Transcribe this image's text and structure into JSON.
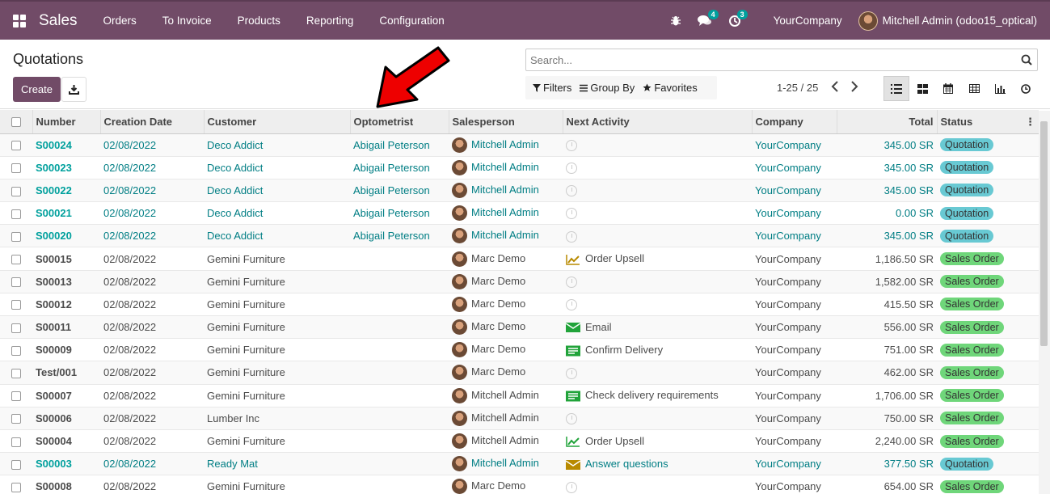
{
  "nav": {
    "brand": "Sales",
    "menu": [
      "Orders",
      "To Invoice",
      "Products",
      "Reporting",
      "Configuration"
    ],
    "messages_badge": "4",
    "activities_badge": "3",
    "company": "YourCompany",
    "user": "Mitchell Admin (odoo15_optical)"
  },
  "control_panel": {
    "title": "Quotations",
    "create_label": "Create",
    "search_placeholder": "Search...",
    "filters_label": "Filters",
    "group_by_label": "Group By",
    "favorites_label": "Favorites",
    "pager": "1-25 / 25"
  },
  "table": {
    "headers": [
      "Number",
      "Creation Date",
      "Customer",
      "Optometrist",
      "Salesperson",
      "Next Activity",
      "Company",
      "Total",
      "Status"
    ],
    "rows": [
      {
        "number": "S00024",
        "date": "02/08/2022",
        "customer": "Deco Addict",
        "optometrist": "Abigail Peterson",
        "salesperson": "Mitchell Admin",
        "activity": "",
        "activity_icon": "clock-icon",
        "company": "YourCompany",
        "total": "345.00 SR",
        "status": "Quotation",
        "type": "quote"
      },
      {
        "number": "S00023",
        "date": "02/08/2022",
        "customer": "Deco Addict",
        "optometrist": "Abigail Peterson",
        "salesperson": "Mitchell Admin",
        "activity": "",
        "activity_icon": "clock-icon",
        "company": "YourCompany",
        "total": "345.00 SR",
        "status": "Quotation",
        "type": "quote"
      },
      {
        "number": "S00022",
        "date": "02/08/2022",
        "customer": "Deco Addict",
        "optometrist": "Abigail Peterson",
        "salesperson": "Mitchell Admin",
        "activity": "",
        "activity_icon": "clock-icon",
        "company": "YourCompany",
        "total": "345.00 SR",
        "status": "Quotation",
        "type": "quote"
      },
      {
        "number": "S00021",
        "date": "02/08/2022",
        "customer": "Deco Addict",
        "optometrist": "Abigail Peterson",
        "salesperson": "Mitchell Admin",
        "activity": "",
        "activity_icon": "clock-icon",
        "company": "YourCompany",
        "total": "0.00 SR",
        "status": "Quotation",
        "type": "quote"
      },
      {
        "number": "S00020",
        "date": "02/08/2022",
        "customer": "Deco Addict",
        "optometrist": "Abigail Peterson",
        "salesperson": "Mitchell Admin",
        "activity": "",
        "activity_icon": "clock-icon",
        "company": "YourCompany",
        "total": "345.00 SR",
        "status": "Quotation",
        "type": "quote"
      },
      {
        "number": "S00015",
        "date": "02/08/2022",
        "customer": "Gemini Furniture",
        "optometrist": "",
        "salesperson": "Marc Demo",
        "activity": "Order Upsell",
        "activity_icon": "upsell-icon",
        "company": "YourCompany",
        "total": "1,186.50 SR",
        "status": "Sales Order",
        "type": "so",
        "activity_color": "#b88a00"
      },
      {
        "number": "S00013",
        "date": "02/08/2022",
        "customer": "Gemini Furniture",
        "optometrist": "",
        "salesperson": "Marc Demo",
        "activity": "",
        "activity_icon": "clock-icon",
        "company": "YourCompany",
        "total": "1,582.00 SR",
        "status": "Sales Order",
        "type": "so"
      },
      {
        "number": "S00012",
        "date": "02/08/2022",
        "customer": "Gemini Furniture",
        "optometrist": "",
        "salesperson": "Marc Demo",
        "activity": "",
        "activity_icon": "clock-icon",
        "company": "YourCompany",
        "total": "415.50 SR",
        "status": "Sales Order",
        "type": "so"
      },
      {
        "number": "S00011",
        "date": "02/08/2022",
        "customer": "Gemini Furniture",
        "optometrist": "",
        "salesperson": "Marc Demo",
        "activity": "Email",
        "activity_icon": "email-icon",
        "company": "YourCompany",
        "total": "556.00 SR",
        "status": "Sales Order",
        "type": "so",
        "activity_color": "#21a33a"
      },
      {
        "number": "S00009",
        "date": "02/08/2022",
        "customer": "Gemini Furniture",
        "optometrist": "",
        "salesperson": "Marc Demo",
        "activity": "Confirm Delivery",
        "activity_icon": "delivery-icon",
        "company": "YourCompany",
        "total": "751.00 SR",
        "status": "Sales Order",
        "type": "so",
        "activity_color": "#21a33a"
      },
      {
        "number": "Test/001",
        "date": "02/08/2022",
        "customer": "Gemini Furniture",
        "optometrist": "",
        "salesperson": "Marc Demo",
        "activity": "",
        "activity_icon": "clock-icon",
        "company": "YourCompany",
        "total": "462.00 SR",
        "status": "Sales Order",
        "type": "so"
      },
      {
        "number": "S00007",
        "date": "02/08/2022",
        "customer": "Gemini Furniture",
        "optometrist": "",
        "salesperson": "Mitchell Admin",
        "activity": "Check delivery requirements",
        "activity_icon": "delivery-icon",
        "company": "YourCompany",
        "total": "1,706.00 SR",
        "status": "Sales Order",
        "type": "so",
        "activity_color": "#21a33a"
      },
      {
        "number": "S00006",
        "date": "02/08/2022",
        "customer": "Lumber Inc",
        "optometrist": "",
        "salesperson": "Mitchell Admin",
        "activity": "",
        "activity_icon": "clock-icon",
        "company": "YourCompany",
        "total": "750.00 SR",
        "status": "Sales Order",
        "type": "so"
      },
      {
        "number": "S00004",
        "date": "02/08/2022",
        "customer": "Gemini Furniture",
        "optometrist": "",
        "salesperson": "Mitchell Admin",
        "activity": "Order Upsell",
        "activity_icon": "upsell-icon",
        "company": "YourCompany",
        "total": "2,240.00 SR",
        "status": "Sales Order",
        "type": "so",
        "activity_color": "#21a33a"
      },
      {
        "number": "S00003",
        "date": "02/08/2022",
        "customer": "Ready Mat",
        "optometrist": "",
        "salesperson": "Mitchell Admin",
        "activity": "Answer questions",
        "activity_icon": "email-icon",
        "company": "YourCompany",
        "total": "377.50 SR",
        "status": "Quotation",
        "type": "quote",
        "activity_color": "#b88a00"
      },
      {
        "number": "S00008",
        "date": "02/08/2022",
        "customer": "Gemini Furniture",
        "optometrist": "",
        "salesperson": "Marc Demo",
        "activity": "",
        "activity_icon": "clock-icon",
        "company": "YourCompany",
        "total": "654.00 SR",
        "status": "Sales Order",
        "type": "so"
      }
    ]
  },
  "colors": {
    "brand": "#714B67",
    "link": "#017e84",
    "quotation_badge": "#68c9d3",
    "sales_order_badge": "#6fd67a",
    "annotation_arrow": "#ee0000"
  }
}
